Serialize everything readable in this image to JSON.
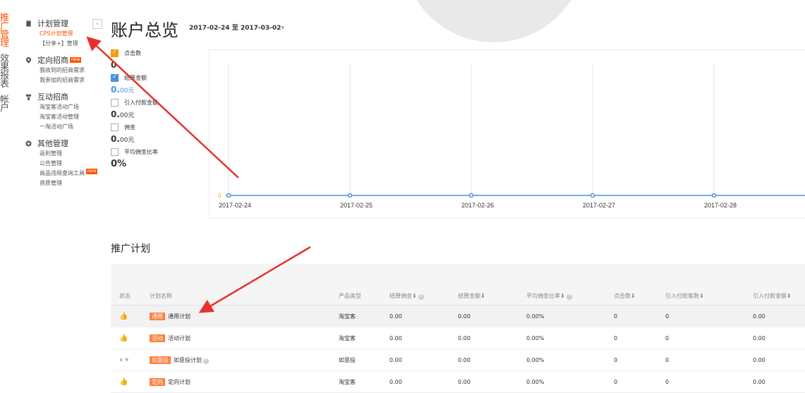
{
  "vnav": [
    {
      "label": "推广管理",
      "active": true
    },
    {
      "label": "效果报表",
      "active": false
    },
    {
      "label": "帐户",
      "active": false
    }
  ],
  "sidebar": {
    "sections": [
      {
        "title": "计划管理",
        "icon": "document-icon",
        "items": [
          {
            "label": "CPS计划管理",
            "active": true
          },
          {
            "label": "【分享+】管理",
            "active": false
          }
        ]
      },
      {
        "title": "定向招商",
        "icon": "pin-icon",
        "badge": "new",
        "items": [
          {
            "label": "我收到的招商需求"
          },
          {
            "label": "我参加的招商需求"
          }
        ]
      },
      {
        "title": "互动招商",
        "icon": "people-icon",
        "items": [
          {
            "label": "淘宝客活动广场"
          },
          {
            "label": "淘宝客活动管理"
          },
          {
            "label": "一淘活动广场"
          }
        ]
      },
      {
        "title": "其他管理",
        "icon": "plus-circle-icon",
        "items": [
          {
            "label": "返利管理"
          },
          {
            "label": "公告管理"
          },
          {
            "label": "商品违规查询工具",
            "badge": "new"
          },
          {
            "label": "资质管理"
          }
        ]
      }
    ],
    "collapse_glyph": "‹"
  },
  "header": {
    "title": "账户总览",
    "date_range": "2017-02-24 至 2017-03-02",
    "dropdown_glyph": "▾"
  },
  "metrics": [
    {
      "label": "点击数",
      "value": "0",
      "unit": "",
      "checked": true,
      "color": "orange"
    },
    {
      "label": "结算金额",
      "value": "0.",
      "unit": "00元",
      "checked": true,
      "color": "blue"
    },
    {
      "label": "引入付款金额",
      "value": "0.",
      "unit": "00元",
      "checked": false
    },
    {
      "label": "佣金",
      "value": "0.",
      "unit": "00元",
      "checked": false
    },
    {
      "label": "平均佣金比率",
      "value": "0%",
      "unit": "",
      "checked": false
    }
  ],
  "chart_data": {
    "type": "line",
    "x": [
      "2017-02-24",
      "2017-02-25",
      "2017-02-26",
      "2017-02-27",
      "2017-02-28"
    ],
    "series": [
      {
        "values": [
          0,
          0,
          0,
          0,
          0
        ]
      }
    ],
    "y_tick": "0",
    "colors": {
      "line": "#4a90e2",
      "y_tick": "#f39c12",
      "grid": "#e5e5e5"
    },
    "grid": true
  },
  "plans": {
    "title": "推广计划",
    "columns": [
      "状态",
      "计划名称",
      "产品类型",
      "结算佣金",
      "结算金额",
      "平均佣金比率",
      "点击数",
      "引入付款笔数",
      "引入付款金额"
    ],
    "sort_glyph": "⬇",
    "help_glyph": "?",
    "rows": [
      {
        "status": "👍",
        "tag": "通用",
        "name": "通用计划",
        "type": "淘宝客",
        "commission": "0.00",
        "amount": "0.00",
        "rate": "0.00%",
        "clicks": "0",
        "orders": "0",
        "pay_amount": "0.00",
        "highlight": true
      },
      {
        "status": "👍",
        "tag": "活动",
        "name": "活动计划",
        "type": "淘宝客",
        "commission": "0.00",
        "amount": "0.00",
        "rate": "0.00%",
        "clicks": "0",
        "orders": "0",
        "pay_amount": "0.00"
      },
      {
        "status": "⏸ ▾",
        "tag": "如意投",
        "name": "如意投计划",
        "type": "如意投",
        "commission": "0.00",
        "amount": "0.00",
        "rate": "0.00%",
        "clicks": "0",
        "orders": "0",
        "pay_amount": "0.00",
        "help": true
      },
      {
        "status": "👍",
        "tag": "定向",
        "name": "定向计划",
        "type": "淘宝客",
        "commission": "0.00",
        "amount": "0.00",
        "rate": "0.00%",
        "clicks": "0",
        "orders": "0",
        "pay_amount": "0.00"
      }
    ]
  },
  "colors": {
    "accent": "#ff5500",
    "tag": "#ff7f3f",
    "arrow": "#e8312e"
  }
}
